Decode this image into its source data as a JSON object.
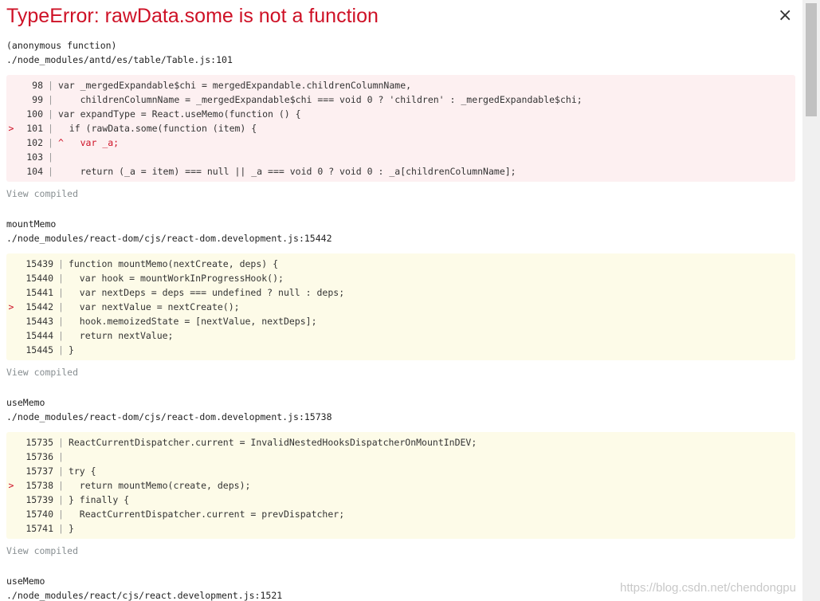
{
  "title": "TypeError: rawData.some is not a function",
  "close_label": "×",
  "watermark": "https://blog.csdn.net/chendongpu",
  "frames": [
    {
      "fn": "(anonymous function)",
      "file": "./node_modules/antd/es/table/Table.js:101",
      "kind": "err",
      "lines": [
        {
          "mark": "",
          "num": "98",
          "code": "var _mergedExpandable$chi = mergedExpandable.childrenColumnName,"
        },
        {
          "mark": "",
          "num": "99",
          "code": "    childrenColumnName = _mergedExpandable$chi === void 0 ? 'children' : _mergedExpandable$chi;"
        },
        {
          "mark": "",
          "num": "100",
          "code": "var expandType = React.useMemo(function () {"
        },
        {
          "mark": ">",
          "num": "101",
          "code": "  if (rawData.some(function (item) {"
        },
        {
          "mark": "",
          "num": "102",
          "code": "^   var _a;",
          "caret": true
        },
        {
          "mark": "",
          "num": "103",
          "code": ""
        },
        {
          "mark": "",
          "num": "104",
          "code": "    return (_a = item) === null || _a === void 0 ? void 0 : _a[childrenColumnName];"
        }
      ],
      "view": "View compiled"
    },
    {
      "fn": "mountMemo",
      "file": "./node_modules/react-dom/cjs/react-dom.development.js:15442",
      "kind": "warn",
      "lines": [
        {
          "mark": "",
          "num": "15439",
          "code": "function mountMemo(nextCreate, deps) {"
        },
        {
          "mark": "",
          "num": "15440",
          "code": "  var hook = mountWorkInProgressHook();"
        },
        {
          "mark": "",
          "num": "15441",
          "code": "  var nextDeps = deps === undefined ? null : deps;"
        },
        {
          "mark": ">",
          "num": "15442",
          "code": "  var nextValue = nextCreate();"
        },
        {
          "mark": "",
          "num": "15443",
          "code": "  hook.memoizedState = [nextValue, nextDeps];"
        },
        {
          "mark": "",
          "num": "15444",
          "code": "  return nextValue;"
        },
        {
          "mark": "",
          "num": "15445",
          "code": "}"
        }
      ],
      "view": "View compiled"
    },
    {
      "fn": "useMemo",
      "file": "./node_modules/react-dom/cjs/react-dom.development.js:15738",
      "kind": "warn",
      "lines": [
        {
          "mark": "",
          "num": "15735",
          "code": "ReactCurrentDispatcher.current = InvalidNestedHooksDispatcherOnMountInDEV;"
        },
        {
          "mark": "",
          "num": "15736",
          "code": ""
        },
        {
          "mark": "",
          "num": "15737",
          "code": "try {"
        },
        {
          "mark": ">",
          "num": "15738",
          "code": "  return mountMemo(create, deps);"
        },
        {
          "mark": "",
          "num": "15739",
          "code": "} finally {"
        },
        {
          "mark": "",
          "num": "15740",
          "code": "  ReactCurrentDispatcher.current = prevDispatcher;"
        },
        {
          "mark": "",
          "num": "15741",
          "code": "}"
        }
      ],
      "view": "View compiled"
    },
    {
      "fn": "useMemo",
      "file": "./node_modules/react/cjs/react.development.js:1521",
      "kind": "none",
      "lines": [],
      "view": ""
    }
  ],
  "colors": {
    "title": "#ce1126",
    "error_bg": "#fdf0f1",
    "warn_bg": "#fdfbe8",
    "muted": "#878e91"
  }
}
